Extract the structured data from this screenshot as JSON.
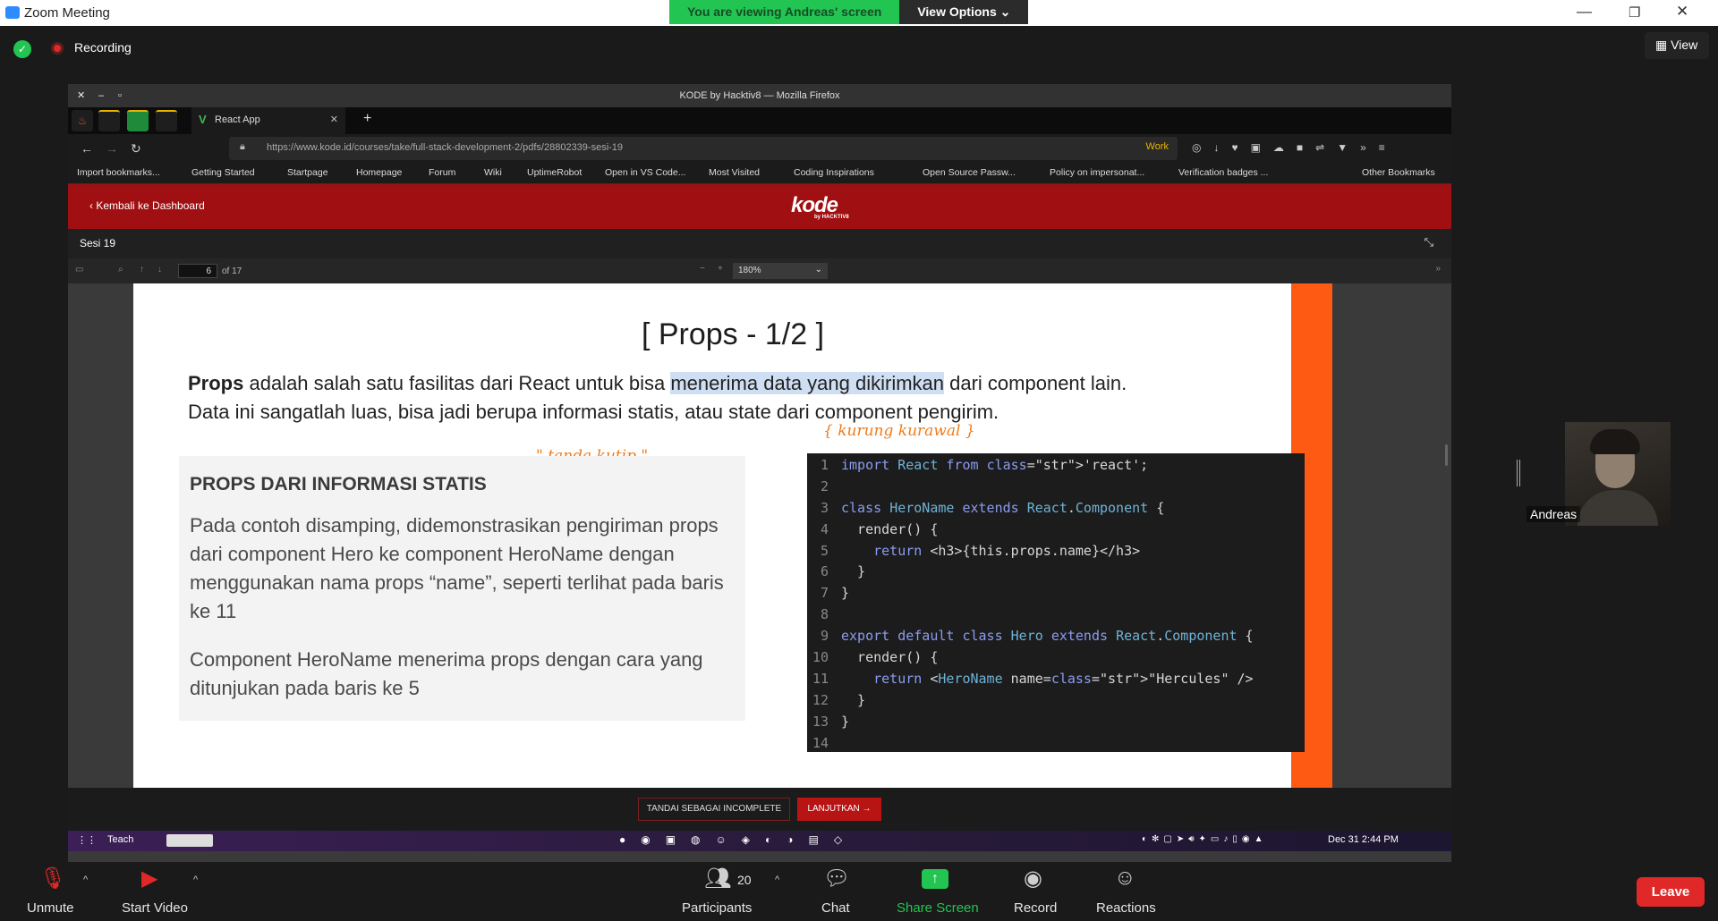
{
  "zoom": {
    "window_title": "Zoom Meeting",
    "viewing_banner": "You are viewing Andreas' screen",
    "view_options": "View Options ⌄",
    "recording": "Recording",
    "view_button": "View",
    "participant_name": "Andreas",
    "participants_count": "20",
    "controls": {
      "unmute": "Unmute",
      "start_video": "Start Video",
      "participants": "Participants",
      "chat": "Chat",
      "share_screen": "Share Screen",
      "record": "Record",
      "reactions": "Reactions",
      "leave": "Leave"
    },
    "colors": {
      "green": "#23c552",
      "leave": "#e02828",
      "accent": "#ff5a14"
    }
  },
  "firefox": {
    "title": "KODE by Hacktiv8 — Mozilla Firefox",
    "tab_title": "React App",
    "url": "https://www.kode.id/courses/take/full-stack-development-2/pdfs/28802339-sesi-19",
    "container_label": "Work",
    "bookmarks": [
      "Import bookmarks...",
      "Getting Started",
      "Startpage",
      "Homepage",
      "Forum",
      "Wiki",
      "UptimeRobot",
      "Open in VS Code...",
      "Most Visited",
      "Coding Inspirations",
      "Open Source Passw...",
      "Policy on impersonat...",
      "Verification badges ...",
      "Other Bookmarks"
    ]
  },
  "kode": {
    "back_link": "Kembali ke Dashboard",
    "logo": "kode",
    "logo_sub": "by HACKTIV8",
    "session_title": "Sesi 19",
    "pdf_page": "6",
    "pdf_page_total": "of 17",
    "pdf_zoom": "180%",
    "btn_incomplete": "TANDAI SEBAGAI INCOMPLETE",
    "btn_next": "LANJUTKAN →"
  },
  "slide": {
    "title": "[ Props - 1/2 ]",
    "intro_bold": "Props",
    "intro_1": " adalah salah satu fasilitas dari React untuk bisa ",
    "intro_hl": "menerima data yang dikirimkan",
    "intro_2": " dari component lain.",
    "intro_line2": "Data ini sangatlah luas, bisa jadi berupa informasi statis, atau state dari component pengirim.",
    "box_heading": "PROPS DARI INFORMASI STATIS",
    "box_p1": "Pada contoh disamping, didemonstrasikan pengiriman props dari component Hero ke component HeroName dengan menggunakan nama props “name”, seperti terlihat pada baris ke 11",
    "box_p2": "Component HeroName menerima props dengan cara yang ditunjukan pada baris ke 5",
    "annotation_1": "\" tanda kutip \"",
    "annotation_2": "{ kurung kurawal }",
    "code_lines": [
      "import React from 'react';",
      "",
      "class HeroName extends React.Component {",
      "  render() {",
      "    return <h3>{this.props.name}</h3>",
      "  }",
      "}",
      "",
      "export default class Hero extends React.Component {",
      "  render() {",
      "    return <HeroName name=\"Hercules\" />",
      "  }",
      "}",
      ""
    ]
  },
  "taskbar": {
    "label": "Teach",
    "clock": "Dec 31   2:44 PM"
  }
}
